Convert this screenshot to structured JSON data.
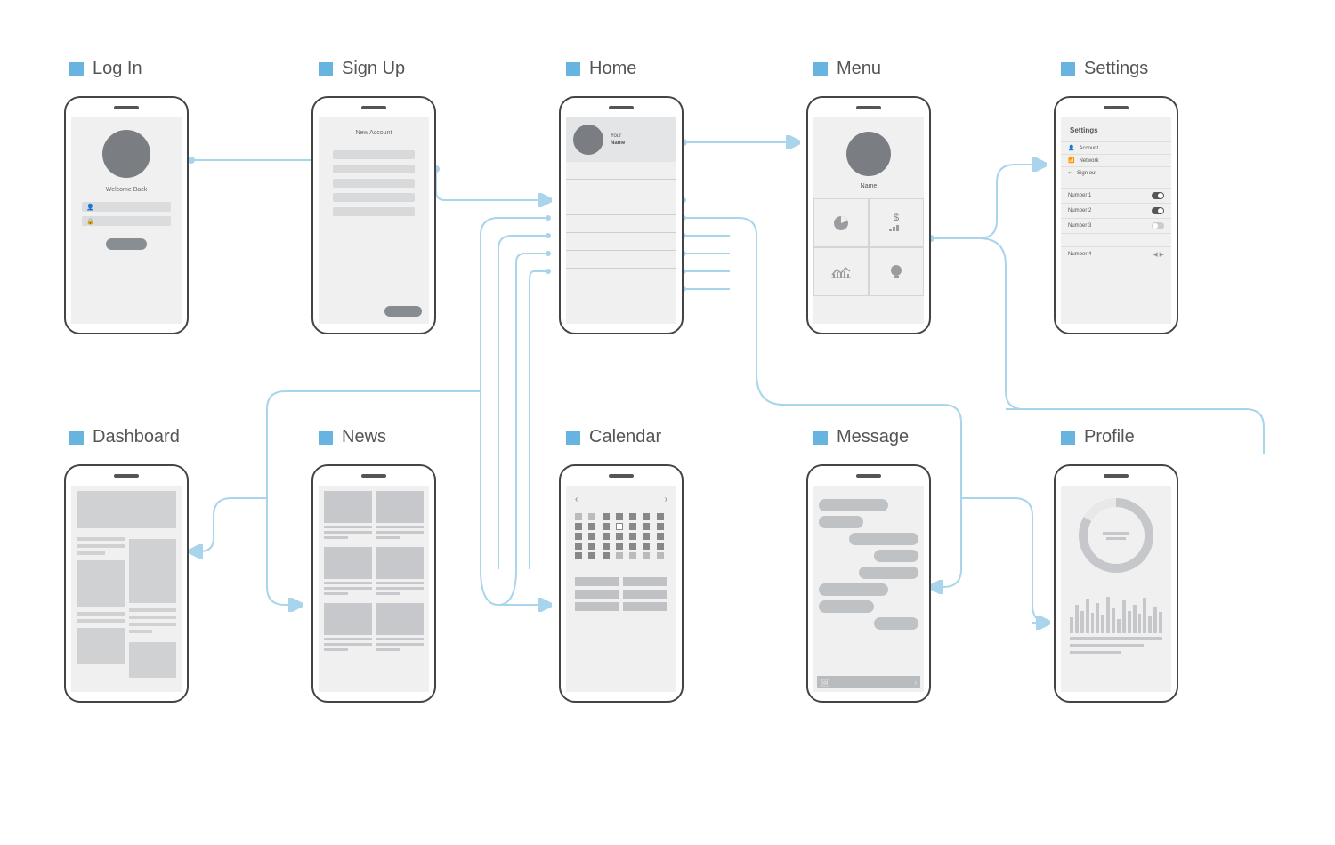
{
  "screens": {
    "login": {
      "title": "Log In",
      "welcome": "Welcome Back",
      "user_icon": "👤",
      "lock_icon": "🔒"
    },
    "signup": {
      "title": "Sign Up",
      "header": "New Account"
    },
    "home": {
      "title": "Home",
      "your": "Your",
      "name": "Name"
    },
    "menu": {
      "title": "Menu",
      "name": "Name",
      "icons": [
        "pie",
        "growth",
        "chart",
        "bulb"
      ]
    },
    "settings": {
      "title": "Settings",
      "header": "Settings",
      "links": [
        {
          "icon": "user",
          "label": "Account"
        },
        {
          "icon": "wifi",
          "label": "Network"
        },
        {
          "icon": "exit",
          "label": "Sign out"
        }
      ],
      "toggles": [
        {
          "label": "Number 1",
          "on": true
        },
        {
          "label": "Number 2",
          "on": true
        },
        {
          "label": "Number 3",
          "on": false
        }
      ],
      "extra": {
        "label": "Number 4"
      }
    },
    "dashboard": {
      "title": "Dashboard"
    },
    "news": {
      "title": "News"
    },
    "calendar": {
      "title": "Calendar",
      "prev": "‹",
      "next": "›"
    },
    "message": {
      "title": "Message",
      "pic_icon": "🖼",
      "send_icon": "›"
    },
    "profile": {
      "title": "Profile"
    }
  },
  "colors": {
    "accent": "#68b4e0",
    "connector": "#a8d4ec",
    "frame": "#444",
    "grey": "#cfd1d3"
  }
}
